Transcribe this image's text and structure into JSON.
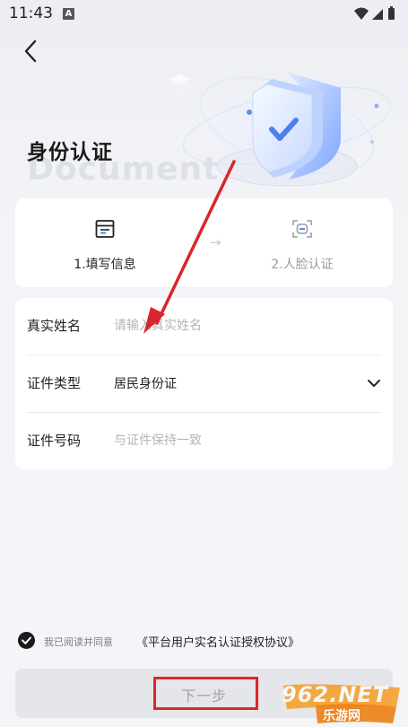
{
  "status_bar": {
    "time": "11:43",
    "badge": "A"
  },
  "header": {
    "title": "身份认证",
    "bg_word": "Document"
  },
  "steps": [
    {
      "label": "1.填写信息",
      "icon": "form-doc-icon",
      "active": true
    },
    {
      "label": "2.人脸认证",
      "icon": "face-scan-icon",
      "active": false
    }
  ],
  "step_arrow": "→",
  "form": {
    "name": {
      "label": "真实姓名",
      "placeholder": "请输入真实姓名"
    },
    "id_type": {
      "label": "证件类型",
      "value": "居民身份证"
    },
    "id_number": {
      "label": "证件号码",
      "placeholder": "与证件保持一致"
    }
  },
  "agreement": {
    "prefix": "我已阅读并同意",
    "link": "《平台用户实名认证授权协议》",
    "checked": true
  },
  "next_button": {
    "label": "下一步"
  },
  "watermark": {
    "main": "962.NET",
    "sub": "乐游网"
  },
  "colors": {
    "accent": "#1b1b1b",
    "annotation": "#e0242a",
    "card": "#ffffff",
    "background": "#f4f5f8"
  }
}
